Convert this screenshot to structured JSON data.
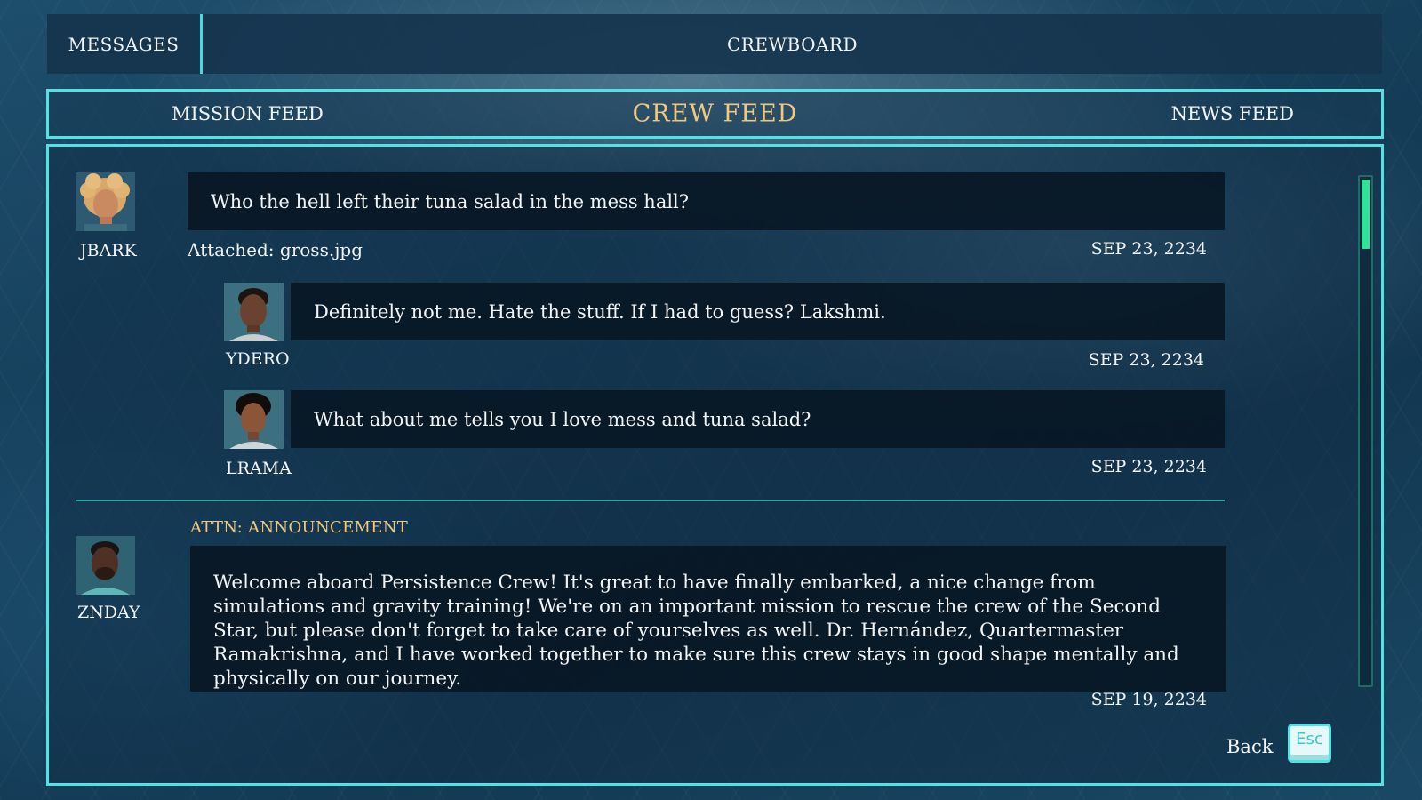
{
  "tabs": {
    "messages": "MESSAGES",
    "crewboard": "CREWBOARD"
  },
  "feed_tabs": {
    "mission": "MISSION FEED",
    "crew": "CREW FEED",
    "news": "NEWS FEED",
    "active_color": "#f0c87e"
  },
  "thread": {
    "post": {
      "user": "JBARK",
      "text": "Who the hell left their tuna salad in the mess hall?",
      "attachment": "Attached: gross.jpg",
      "date": "SEP 23, 2234"
    },
    "replies": [
      {
        "user": "YDERO",
        "text": "Definitely not me. Hate the stuff. If I had to guess? Lakshmi.",
        "date": "SEP 23, 2234"
      },
      {
        "user": "LRAMA",
        "text": "What about me tells you I love mess and tuna salad?",
        "date": "SEP 23, 2234"
      }
    ]
  },
  "announcement": {
    "label": "ATTN: ANNOUNCEMENT",
    "user": "ZNDAY",
    "text": "Welcome aboard Persistence Crew! It's great to have finally embarked, a nice change from simulations and gravity training! We're on an important mission to rescue the crew of the Second Star, but please don't forget to take care of yourselves as well. Dr. Hernández, Quartermaster Ramakrishna, and I have worked together to make sure this crew stays in good shape mentally and physically on our journey.",
    "date": "SEP 19, 2234"
  },
  "footer": {
    "back": "Back",
    "key": "Esc"
  },
  "colors": {
    "accent": "#52e2e3",
    "highlight": "#f0c87e",
    "scroll": "#33e29a"
  },
  "scroll_position": 0.0
}
